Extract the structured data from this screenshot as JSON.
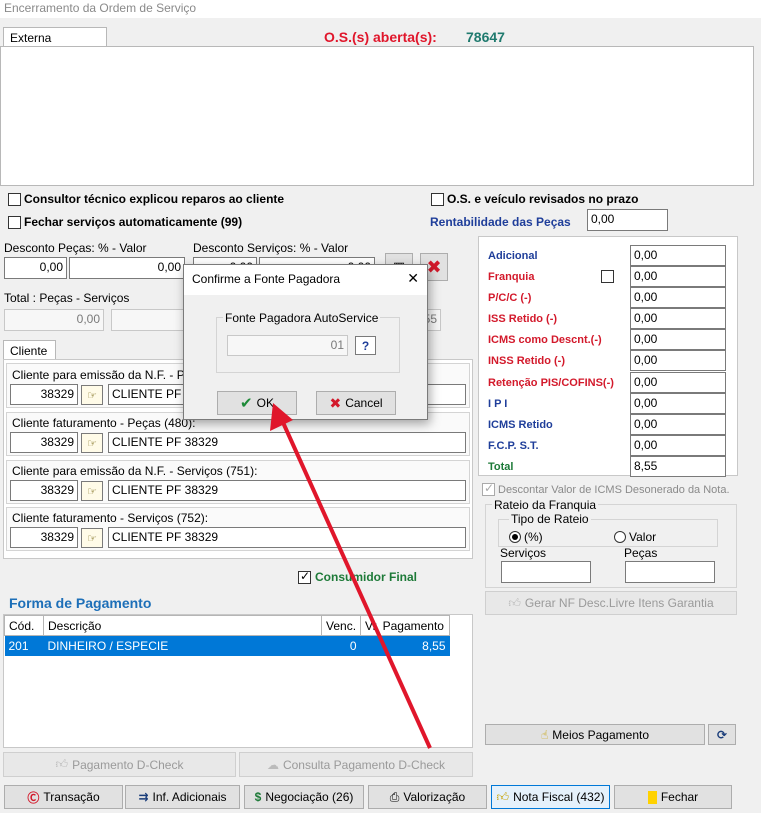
{
  "window": {
    "title": "Encerramento da Ordem de Serviço"
  },
  "header": {
    "tab_label": "Externa",
    "os_label": "O.S.(s) aberta(s):",
    "os_number": "78647"
  },
  "checks": {
    "consultor": "Consultor técnico explicou reparos ao cliente",
    "fechar": "Fechar serviços automaticamente (99)",
    "veiculo": "O.S. e veículo revisados no prazo",
    "rentabilidade_label": "Rentabilidade das Peças",
    "rentabilidade_value": "0,00"
  },
  "discounts": {
    "pecas_label": "Desconto Peças: % - Valor",
    "pecas_pct": "0,00",
    "pecas_val": "0,00",
    "servicos_label": "Desconto Serviços: % - Valor",
    "servicos_pct": "0,00",
    "servicos_val": "0,00",
    "total_label": "Total : Peças - Serviços",
    "total_pecas": "0,00",
    "total_servicos": "8,55"
  },
  "client": {
    "tab_label": "Cliente",
    "groups": [
      {
        "label": "Cliente para emissão da N.F. - Peças (479):",
        "code": "38329",
        "name": "CLIENTE PF 38329"
      },
      {
        "label": "Cliente faturamento - Peças (480):",
        "code": "38329",
        "name": "CLIENTE PF 38329"
      },
      {
        "label": "Cliente para emissão da N.F. - Serviços (751):",
        "code": "38329",
        "name": "CLIENTE PF 38329"
      },
      {
        "label": "Cliente faturamento - Serviços (752):",
        "code": "38329",
        "name": "CLIENTE PF 38329"
      }
    ],
    "consumidor_final": "Consumidor Final"
  },
  "payment": {
    "section_title": "Forma de Pagamento",
    "columns": [
      "Cód.",
      "Descrição",
      "Venc.",
      "Vr. Pagamento"
    ],
    "rows": [
      {
        "cod": "201",
        "descricao": "DINHEIRO / ESPECIE",
        "venc": "0",
        "valor": "8,55"
      }
    ]
  },
  "totals": {
    "adicional": {
      "label": "Adicional",
      "value": "0,00"
    },
    "franquia": {
      "label": "Franquia",
      "value": "0,00"
    },
    "pcc": {
      "label": "P/C/C (-)",
      "value": "0,00"
    },
    "iss": {
      "label": "ISS Retido (-)",
      "value": "0,00"
    },
    "icms_desc": {
      "label": "ICMS como Descnt.(-)",
      "value": "0,00"
    },
    "inss": {
      "label": "INSS Retido (-)",
      "value": "0,00"
    },
    "pis": {
      "label": "Retenção PIS/COFINS(-)",
      "value": "0,00"
    },
    "ipi": {
      "label": "I P I",
      "value": "0,00"
    },
    "icms_retido": {
      "label": "ICMS Retido",
      "value": "0,00"
    },
    "fcp": {
      "label": "F.C.P.  S.T.",
      "value": "0,00"
    },
    "total": {
      "label": "Total",
      "value": "8,55"
    },
    "descontar_icms": "Descontar Valor de ICMS Desonerado da Nota."
  },
  "rateio": {
    "title": "Rateio da Franquia",
    "tipo_title": "Tipo de Rateio",
    "opt_pct": "(%)",
    "opt_valor": "Valor",
    "servicos": "Serviços",
    "pecas": "Peças",
    "gerar_nf": "Gerar NF Desc.Livre Itens Garantia"
  },
  "buttons": {
    "meios": "Meios Pagamento",
    "pag_dcheck": "Pagamento D-Check",
    "consulta_dcheck": "Consulta Pagamento D-Check",
    "transacao": "Transação",
    "inf_adicionais": "Inf. Adicionais",
    "negociacao": "Negociação (26)",
    "valorizacao": "Valorização",
    "nota_fiscal": "Nota Fiscal (432)",
    "fechar": "Fechar"
  },
  "dialog": {
    "title": "Confirme a Fonte Pagadora",
    "close": "✕",
    "group_label": "Fonte Pagadora AutoService",
    "value": "01",
    "ok": "OK",
    "cancel": "Cancel"
  },
  "colors": {
    "red_accent": "#e0162b",
    "os_number": "#1f7a6e",
    "selection": "#0078d7"
  }
}
